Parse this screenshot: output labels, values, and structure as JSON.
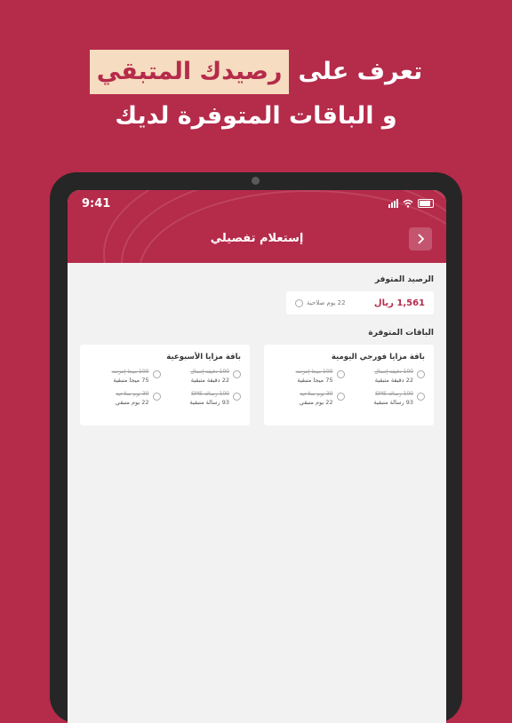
{
  "headline": {
    "line1_start": "تعرف على",
    "line1_highlight": "رصيدك المتبقي",
    "line2": "و الباقات المتوفرة لديك"
  },
  "status_bar": {
    "time": "9:41"
  },
  "header": {
    "title": "إستعلام تفصيلي",
    "back_icon": "chevron-right-icon"
  },
  "balance": {
    "section_title": "الرصيد المتوفر",
    "amount": "1,561 ريال",
    "validity": "22 يوم صلاحية"
  },
  "packages": {
    "section_title": "الباقات المتوفرة",
    "items": [
      {
        "title": "باقة مزايا فورجي اليومية",
        "stats": [
          {
            "icon": "phone-icon",
            "total": "100 دقيقة إتصال",
            "remaining": "22 دقيقة متبقية"
          },
          {
            "icon": "globe-icon",
            "total": "100 ميجا إنترنت",
            "remaining": "75 ميجا متبقية"
          },
          {
            "icon": "message-icon",
            "total": "100 رسالة SMS",
            "remaining": "93 رسالة متبقية"
          },
          {
            "icon": "clock-icon",
            "total": "30 يوم صلاحية",
            "remaining": "22 يوم متبقي"
          }
        ]
      },
      {
        "title": "باقة مزايا الأسبوعية",
        "stats": [
          {
            "icon": "phone-icon",
            "total": "100 دقيقة إتصال",
            "remaining": "22 دقيقة متبقية"
          },
          {
            "icon": "globe-icon",
            "total": "100 ميجا إنترنت",
            "remaining": "75 ميجا متبقية"
          },
          {
            "icon": "message-icon",
            "total": "100 رسالة SMS",
            "remaining": "93 رسالة متبقية"
          },
          {
            "icon": "clock-icon",
            "total": "30 يوم صلاحية",
            "remaining": "22 يوم متبقي"
          }
        ]
      }
    ]
  },
  "colors": {
    "brand": "#b52b4a",
    "highlight": "#f6dcc0",
    "device": "#262626",
    "screen_bg": "#f2f2f2"
  }
}
